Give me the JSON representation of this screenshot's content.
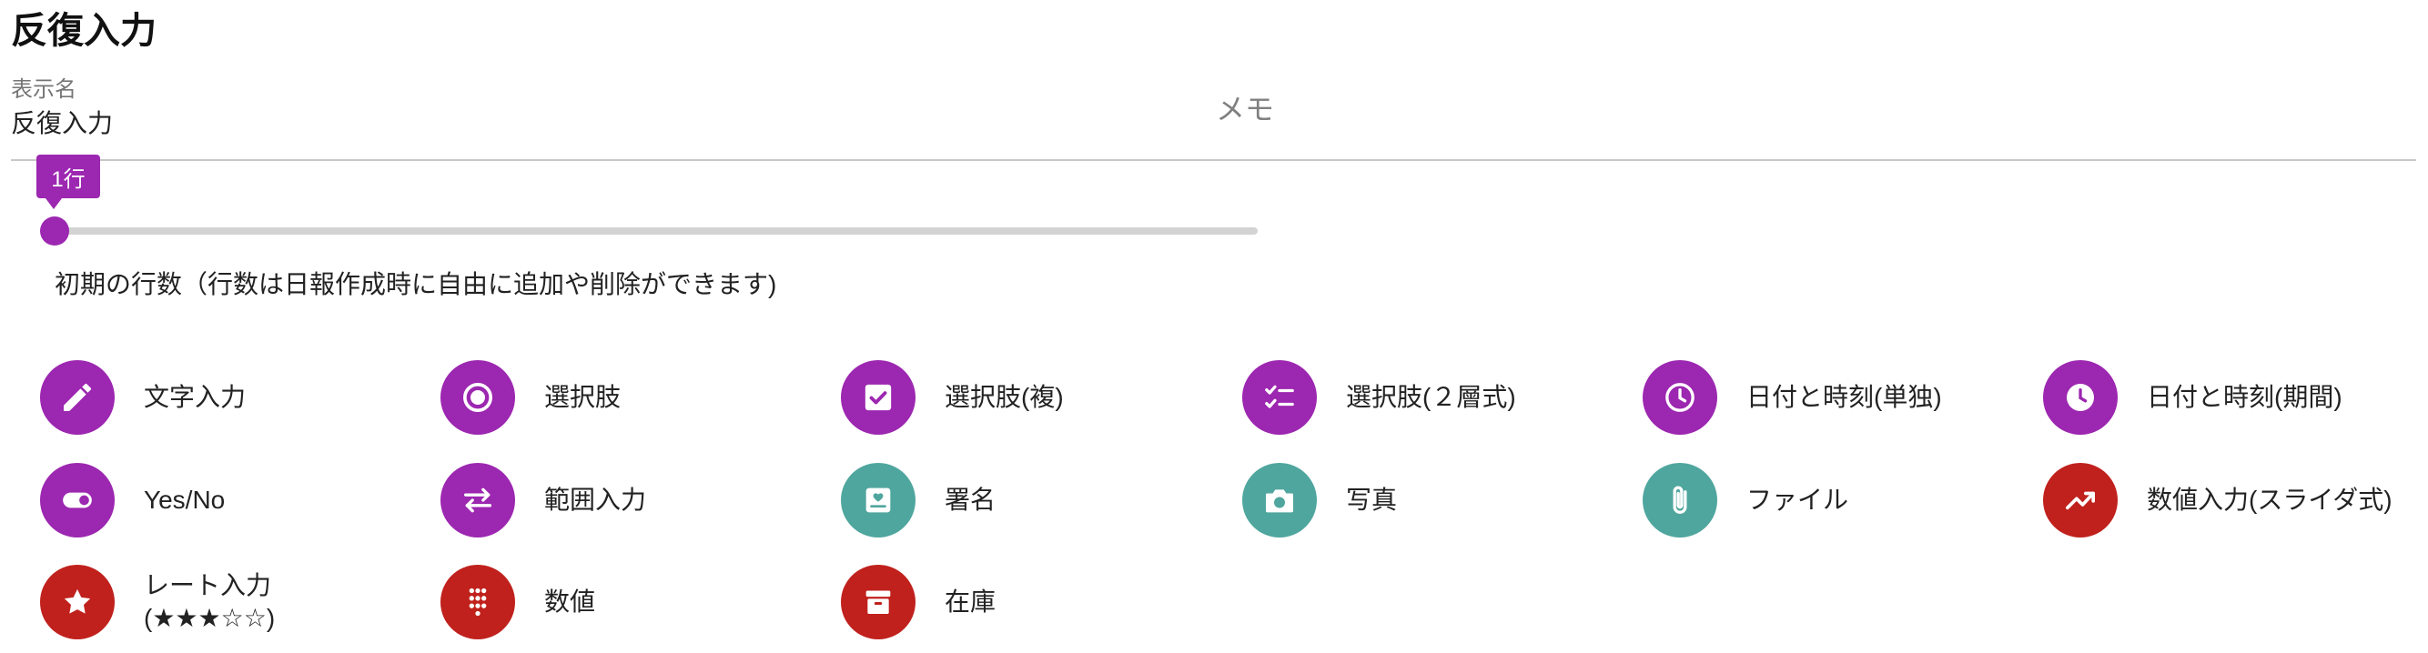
{
  "page": {
    "title": "反復入力"
  },
  "form": {
    "display_name_label": "表示名",
    "display_name_value": "反復入力",
    "memo_placeholder": "メモ"
  },
  "slider": {
    "value_label": "1行",
    "value": 1,
    "caption": "初期の行数（行数は日報作成時に自由に追加や削除ができます)"
  },
  "colors": {
    "purple": "#9c27b0",
    "teal": "#4fa69e",
    "red": "#c0211d"
  },
  "items": [
    {
      "label": "文字入力",
      "icon": "pencil-icon",
      "color": "purple"
    },
    {
      "label": "選択肢",
      "icon": "radio-button-icon",
      "color": "purple"
    },
    {
      "label": "選択肢(複)",
      "icon": "checkbox-icon",
      "color": "purple"
    },
    {
      "label": "選択肢(２層式)",
      "icon": "checklist-icon",
      "color": "purple"
    },
    {
      "label": "日付と時刻(単独)",
      "icon": "clock-outline-icon",
      "color": "purple"
    },
    {
      "label": "日付と時刻(期間)",
      "icon": "clock-filled-icon",
      "color": "purple"
    },
    {
      "label": "Yes/No",
      "icon": "toggle-icon",
      "color": "purple"
    },
    {
      "label": "範囲入力",
      "icon": "swap-arrows-icon",
      "color": "purple"
    },
    {
      "label": "署名",
      "icon": "signature-icon",
      "color": "teal"
    },
    {
      "label": "写真",
      "icon": "camera-icon",
      "color": "teal"
    },
    {
      "label": "ファイル",
      "icon": "paperclip-icon",
      "color": "teal"
    },
    {
      "label": "数値入力(スライダ式)",
      "icon": "trending-up-icon",
      "color": "red"
    },
    {
      "label_line1": "レート入力",
      "label_line2": "(★★★☆☆)",
      "icon": "star-icon",
      "color": "red"
    },
    {
      "label": "数値",
      "icon": "dialpad-icon",
      "color": "red"
    },
    {
      "label": "在庫",
      "icon": "archive-box-icon",
      "color": "red"
    }
  ]
}
